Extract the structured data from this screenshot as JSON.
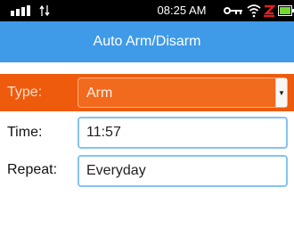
{
  "status_bar": {
    "time": "08:25 AM",
    "icons": [
      "signal-bars-icon",
      "data-arrows-icon",
      "key-icon",
      "wifi-icon",
      "alarm-icon",
      "battery-icon"
    ]
  },
  "header": {
    "title": "Auto Arm/Disarm"
  },
  "form": {
    "type": {
      "label": "Type:",
      "value": "Arm"
    },
    "time": {
      "label": "Time:",
      "value": "11:57"
    },
    "repeat": {
      "label": "Repeat:",
      "value": "Everyday"
    }
  },
  "colors": {
    "title_bar": "#3f9ae8",
    "type_row": "#ef5b0d",
    "input_border": "#84c3f2"
  }
}
